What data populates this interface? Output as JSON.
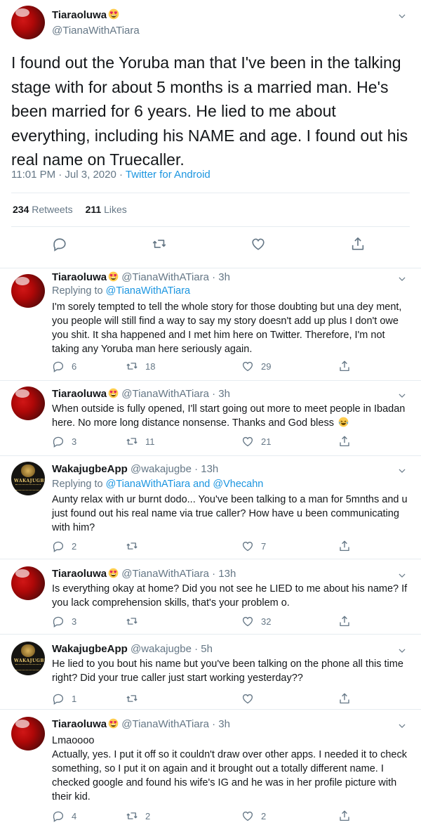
{
  "main_tweet": {
    "display_name": "Tiaraoluwa",
    "handle": "@TianaWithATiara",
    "text": "I found out the Yoruba man that I've been in the talking stage with for about 5 months is a married man. He's been married for 6 years. He lied to me about everything, including his NAME and age. I found out his real name on Truecaller.",
    "timestamp": "11:01 PM · Jul 3, 2020 · ",
    "source": "Twitter for Android",
    "retweets_count": "234",
    "retweets_label": "Retweets",
    "likes_count": "211",
    "likes_label": "Likes",
    "icons": [
      "reply-icon",
      "retweet-icon",
      "heart-icon",
      "share-icon",
      "chevron-down-icon"
    ]
  },
  "replies": [
    {
      "display_name": "Tiaraoluwa",
      "meta": "@TianaWithATiara · 3h",
      "replying_prefix": "Replying to ",
      "replying_to": "@TianaWithATiara",
      "text": "I'm sorely tempted to tell the whole story for those doubting but una dey ment, you people will still find a way to say my story doesn't add up plus I don't owe you shit. It sha happened and I met him here on Twitter. Therefore, I'm not taking any Yoruba man here seriously again.",
      "reply_count": "6",
      "retweet_count": "18",
      "like_count": "29",
      "avatar": "red"
    },
    {
      "display_name": "Tiaraoluwa",
      "meta": "@TianaWithATiara · 3h",
      "replying_prefix": "",
      "replying_to": "",
      "text": "When outside is fully opened, I'll start going out more to meet people in Ibadan here. No more long distance nonsense. Thanks and God bless",
      "reply_count": "3",
      "retweet_count": "11",
      "like_count": "21",
      "avatar": "red"
    },
    {
      "display_name": "WakajugbeApp",
      "meta": "@wakajugbe · 13h",
      "replying_prefix": "Replying to ",
      "replying_to": "@TianaWithATiara and @Vhecahn",
      "text": "Aunty relax with ur burnt dodo... You've been talking to a man for 5mnths and u just found out his real name via true caller? How have u been communicating with him?",
      "reply_count": "2",
      "retweet_count": "",
      "like_count": "7",
      "avatar": "waka",
      "avatar_text": "WAKAJUGBE"
    },
    {
      "display_name": "Tiaraoluwa",
      "meta": "@TianaWithATiara · 13h",
      "replying_prefix": "",
      "replying_to": "",
      "text": "Is everything okay at home? Did you not see he LIED to me about his name? If you lack comprehension skills, that's your problem o.",
      "reply_count": "3",
      "retweet_count": "",
      "like_count": "32",
      "avatar": "red"
    },
    {
      "display_name": "WakajugbeApp",
      "meta": "@wakajugbe · 5h",
      "replying_prefix": "",
      "replying_to": "",
      "text": "He lied to you bout his name but you've been talking on the phone all this time right? Did your true caller just start working yesterday??",
      "reply_count": "1",
      "retweet_count": "",
      "like_count": "",
      "avatar": "waka",
      "avatar_text": "WAKAJUGBE"
    },
    {
      "display_name": "Tiaraoluwa",
      "meta": "@TianaWithATiara · 3h",
      "replying_prefix": "",
      "replying_to": "",
      "text_first": "Lmaoooo",
      "text": "Actually, yes. I put it off so it couldn't draw over other apps. I needed it to check something, so I put it on again and it brought out a totally different name. I checked google and found his wife's IG and he was in her profile picture with their kid.",
      "reply_count": "4",
      "retweet_count": "2",
      "like_count": "2",
      "avatar": "red"
    }
  ],
  "colors": {
    "link": "#1b95e0",
    "secondary_text": "#657786",
    "primary_text": "#14171a",
    "border": "#e6ecf0"
  }
}
